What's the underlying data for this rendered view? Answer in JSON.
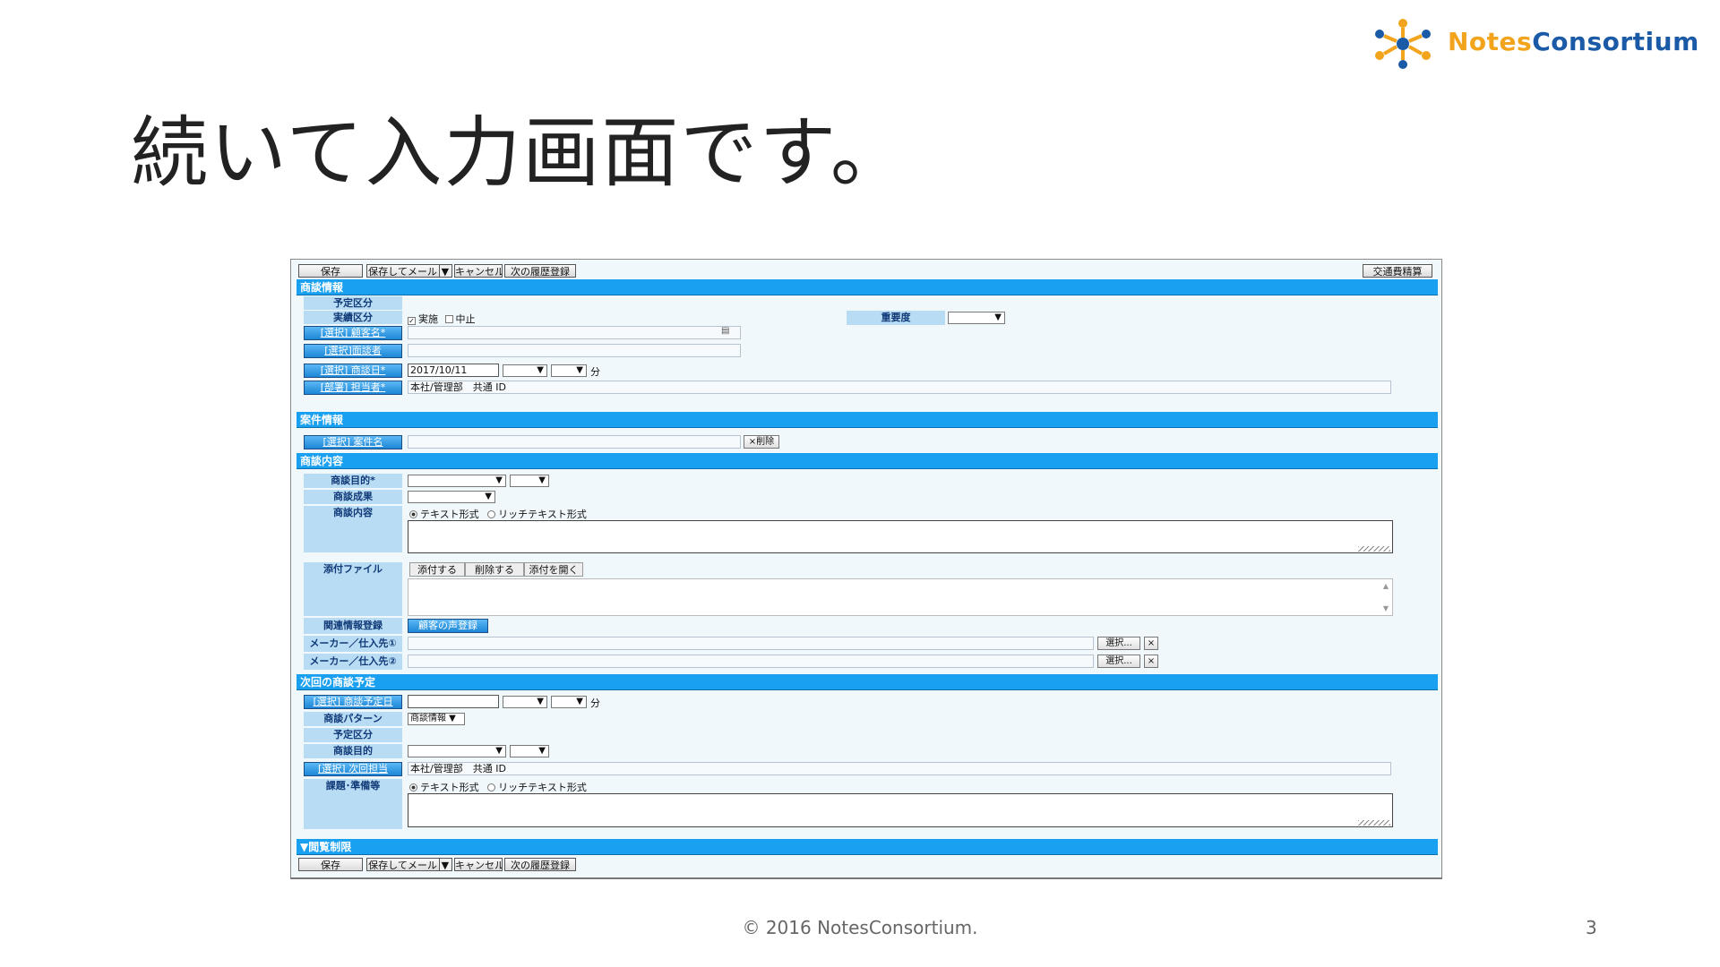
{
  "slide": {
    "title": "続いて入力画面です。",
    "footer": "© 2016 NotesConsortium.",
    "page_number": "3",
    "logo": {
      "part1": "Notes",
      "part2": "Consortium",
      "icon": "consortium-logo-icon"
    }
  },
  "form": {
    "toolbar": {
      "save": "保存",
      "save_mail": "保存してメール",
      "cancel": "キャンセル",
      "next_history": "次の履歴登録",
      "transport_expense": "交通費精算"
    },
    "sections": {
      "business_info": "商談情報",
      "case_info": "案件情報",
      "business_content": "商談内容",
      "next_plan": "次回の商談予定",
      "view_restriction": "▼閲覧制限"
    },
    "labels": {
      "plan_type": "予定区分",
      "actual_type": "実績区分",
      "importance": "重要度",
      "customer_name": "[選択] 顧客名*",
      "contact": "[選択]面談者",
      "meeting_date": "[選択] 商談日*",
      "person_in_charge": "[部署] 担当者*",
      "case_name": "[選択] 案件名",
      "purpose": "商談目的*",
      "result": "商談成果",
      "content": "商談内容",
      "attachment": "添付ファイル",
      "related": "関連情報登録",
      "maker1": "メーカー／仕入先①",
      "maker2": "メーカー／仕入先②",
      "next_date": "[選択] 商談予定日",
      "pattern": "商談パターン",
      "next_plan_type": "予定区分",
      "next_purpose": "商談目的",
      "next_person": "[選択] 次回担当",
      "issues": "課題･準備等"
    },
    "values": {
      "done": "実施",
      "stopped": "中止",
      "date": "2017/10/11",
      "minute": "分",
      "person": "本社/管理部　共通 ID",
      "delete_case": "×削除",
      "plain_text": "テキスト形式",
      "rich_text": "リッチテキスト形式",
      "attach": "添付する",
      "delete_attach": "削除する",
      "open_attach": "添付を開く",
      "customer_voice": "顧客の声登録",
      "select": "選択...",
      "clear": "×",
      "pattern_value": "商談情報"
    }
  }
}
